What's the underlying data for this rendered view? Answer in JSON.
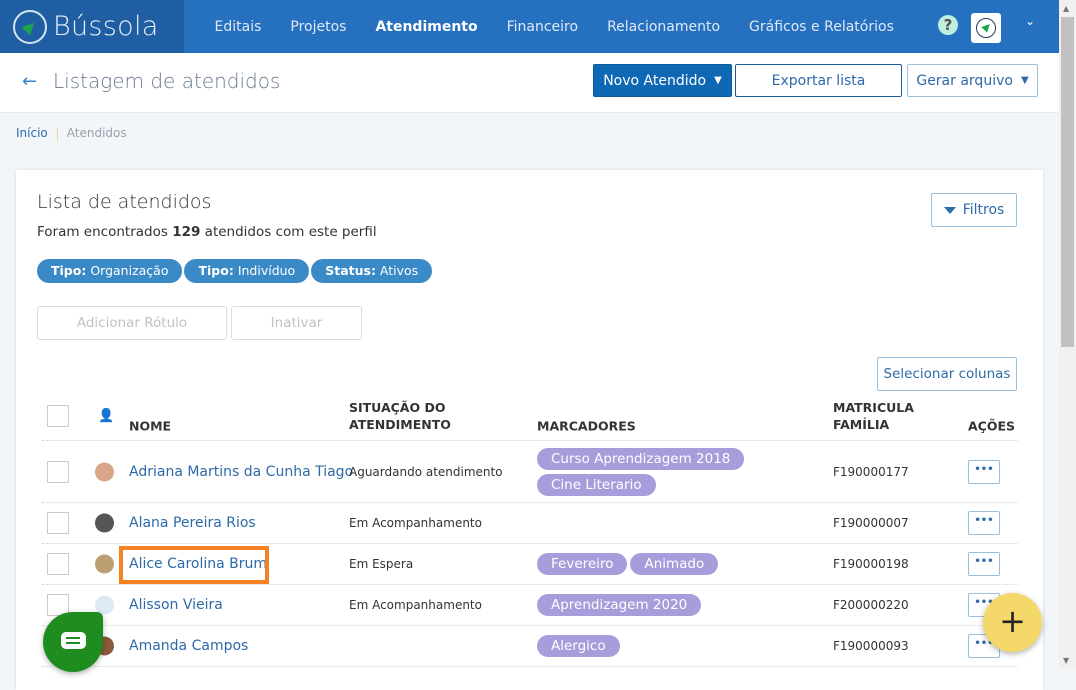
{
  "nav": {
    "logo": "Bússola",
    "items": [
      "Editais",
      "Projetos",
      "Atendimento",
      "Financeiro",
      "Relacionamento",
      "Gráficos e Relatórios"
    ],
    "active": "Atendimento",
    "help": "?"
  },
  "header": {
    "title": "Listagem de atendidos",
    "new_btn": "Novo Atendido",
    "export_btn": "Exportar lista",
    "generate_btn": "Gerar arquivo"
  },
  "breadcrumb": [
    "Início",
    "Atendidos"
  ],
  "card": {
    "title": "Lista de atendidos",
    "sub_pre": "Foram encontrados ",
    "count": "129",
    "sub_post": " atendidos com este perfil",
    "filters_btn": "Filtros",
    "chips": [
      {
        "k": "Tipo:",
        "v": " Organização"
      },
      {
        "k": "Tipo:",
        "v": " Indivíduo"
      },
      {
        "k": "Status:",
        "v": " Ativos"
      }
    ],
    "add_label_btn": "Adicionar Rótulo",
    "inactivate_btn": "Inativar",
    "select_columns_btn": "Selecionar colunas"
  },
  "table": {
    "headers": {
      "name": "NOME",
      "status1": "SITUAÇÃO DO",
      "status2": "ATENDIMENTO",
      "tags": "MARCADORES",
      "mat1": "MATRICULA",
      "mat2": "FAMÍLIA",
      "actions": "AÇÕES"
    },
    "rows": [
      {
        "name": "Adriana Martins da Cunha Tiago",
        "status": "Aguardando atendimento",
        "tags": [
          "Curso Aprendizagem 2018",
          "Cine Literario"
        ],
        "mat": "F190000177",
        "actions": "•••"
      },
      {
        "name": "Alana Pereira Rios",
        "status": "Em Acompanhamento",
        "tags": [],
        "mat": "F190000007",
        "actions": "•••"
      },
      {
        "name": "Alice Carolina Brum",
        "status": "Em Espera",
        "tags": [
          "Fevereiro",
          "Animado"
        ],
        "mat": "F190000198",
        "actions": "•••"
      },
      {
        "name": "Alisson Vieira",
        "status": "Em Acompanhamento",
        "tags": [
          "Aprendizagem 2020"
        ],
        "mat": "F200000220",
        "actions": "•••"
      },
      {
        "name": "Amanda Campos",
        "status": "",
        "tags": [
          "Alergico"
        ],
        "mat": "F190000093",
        "actions": "•••"
      }
    ]
  },
  "fab": "+"
}
